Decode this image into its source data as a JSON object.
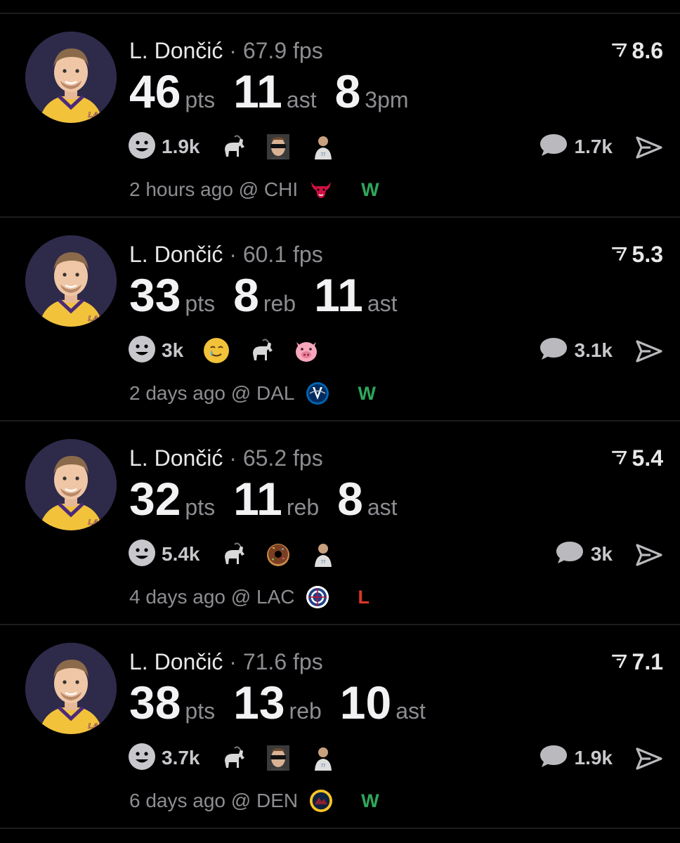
{
  "colors": {
    "background": "#000000",
    "win": "#2fa65a",
    "loss": "#e0342b",
    "muted": "#8d8d92"
  },
  "posts": [
    {
      "player": "L. Dončić",
      "separator": "·",
      "fps_value": "67.9",
      "fps_unit": "fps",
      "score": "8.6",
      "stats": [
        {
          "value": "46",
          "unit": "pts"
        },
        {
          "value": "11",
          "unit": "ast"
        },
        {
          "value": "8",
          "unit": "3pm"
        }
      ],
      "reaction_count": "1.9k",
      "emojis": [
        "goat-icon",
        "sunglasses-player-icon",
        "player-photo-icon"
      ],
      "comment_count": "1.7k",
      "time": "2 hours ago",
      "at": "@",
      "opponent": "CHI",
      "opponent_logo": "bulls-logo-icon",
      "result": "W"
    },
    {
      "player": "L. Dončić",
      "separator": "·",
      "fps_value": "60.1",
      "fps_unit": "fps",
      "score": "5.3",
      "stats": [
        {
          "value": "33",
          "unit": "pts"
        },
        {
          "value": "8",
          "unit": "reb"
        },
        {
          "value": "11",
          "unit": "ast"
        }
      ],
      "reaction_count": "3k",
      "emojis": [
        "tear-smile-icon",
        "goat-icon",
        "pig-icon"
      ],
      "comment_count": "3.1k",
      "time": "2 days ago",
      "at": "@",
      "opponent": "DAL",
      "opponent_logo": "mavericks-logo-icon",
      "result": "W"
    },
    {
      "player": "L. Dončić",
      "separator": "·",
      "fps_value": "65.2",
      "fps_unit": "fps",
      "score": "5.4",
      "stats": [
        {
          "value": "32",
          "unit": "pts"
        },
        {
          "value": "11",
          "unit": "reb"
        },
        {
          "value": "8",
          "unit": "ast"
        }
      ],
      "reaction_count": "5.4k",
      "emojis": [
        "goat-icon",
        "donut-icon",
        "player-photo-icon"
      ],
      "comment_count": "3k",
      "time": "4 days ago",
      "at": "@",
      "opponent": "LAC",
      "opponent_logo": "clippers-logo-icon",
      "result": "L"
    },
    {
      "player": "L. Dončić",
      "separator": "·",
      "fps_value": "71.6",
      "fps_unit": "fps",
      "score": "7.1",
      "stats": [
        {
          "value": "38",
          "unit": "pts"
        },
        {
          "value": "13",
          "unit": "reb"
        },
        {
          "value": "10",
          "unit": "ast"
        }
      ],
      "reaction_count": "3.7k",
      "emojis": [
        "goat-icon",
        "sunglasses-player-icon",
        "player-photo-icon"
      ],
      "comment_count": "1.9k",
      "time": "6 days ago",
      "at": "@",
      "opponent": "DEN",
      "opponent_logo": "nuggets-logo-icon",
      "result": "W"
    }
  ]
}
